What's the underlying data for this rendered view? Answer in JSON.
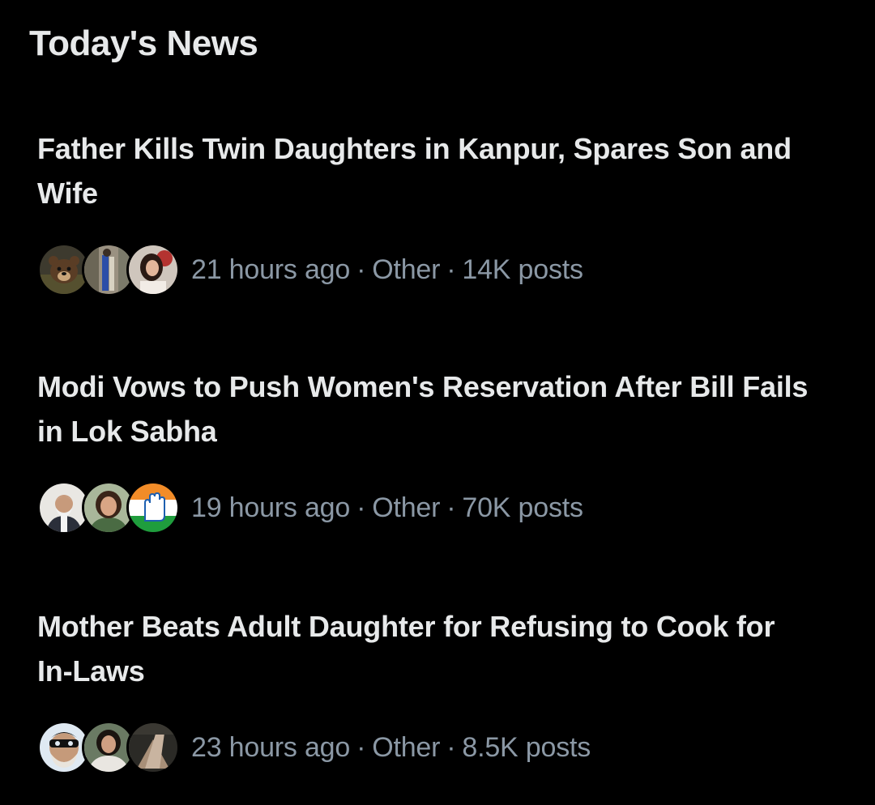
{
  "section": {
    "title": "Today's News"
  },
  "news": [
    {
      "headline": "Father Kills Twin Daughters in Kanpur, Spares Son and Wife",
      "time": "21 hours ago",
      "category": "Other",
      "posts": "14K posts",
      "avatars": [
        "bear-avatar",
        "person-avatar",
        "woman-avatar"
      ]
    },
    {
      "headline": "Modi Vows to Push Women's Reservation After Bill Fails in Lok Sabha",
      "time": "19 hours ago",
      "category": "Other",
      "posts": "70K posts",
      "avatars": [
        "man-avatar",
        "woman-avatar",
        "hand-logo-avatar"
      ]
    },
    {
      "headline": "Mother Beats Adult Daughter for Refusing to Cook for In-Laws",
      "time": "23 hours ago",
      "category": "Other",
      "posts": "8.5K posts",
      "avatars": [
        "masked-man-avatar",
        "woman-avatar",
        "hand-avatar"
      ]
    }
  ],
  "separator": "·",
  "colors": {
    "background": "#000000",
    "headline": "#e7e9ea",
    "meta": "#8b98a5"
  }
}
